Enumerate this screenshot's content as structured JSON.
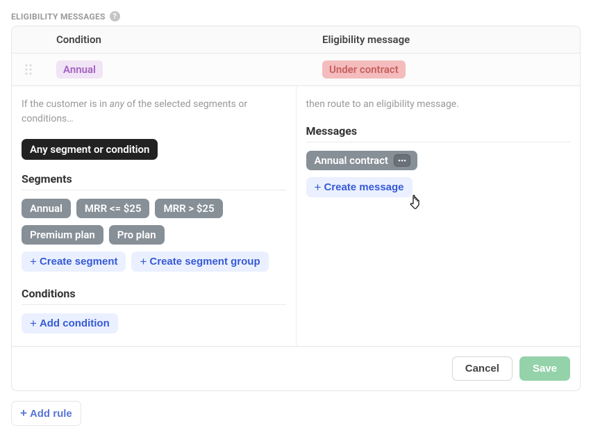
{
  "header": {
    "title": "ELIGIBILITY MESSAGES"
  },
  "columns": {
    "condition": "Condition",
    "eligibility": "Eligibility message"
  },
  "rule": {
    "condition_chip": "Annual",
    "eligibility_chip": "Under contract"
  },
  "left_panel": {
    "helper_pre": "If the customer is in ",
    "helper_em": "any",
    "helper_post": " of the selected segments or conditions…",
    "any_chip": "Any segment or condition",
    "segments_heading": "Segments",
    "segments": [
      "Annual",
      "MRR <= $25",
      "MRR > $25",
      "Premium plan",
      "Pro plan"
    ],
    "create_segment": "Create segment",
    "create_segment_group": "Create segment group",
    "conditions_heading": "Conditions",
    "add_condition": "Add condition"
  },
  "right_panel": {
    "helper": "then route to an eligibility message.",
    "messages_heading": "Messages",
    "message_chip": "Annual contract",
    "create_message": "Create message"
  },
  "footer": {
    "cancel": "Cancel",
    "save": "Save"
  },
  "add_rule": "Add rule"
}
